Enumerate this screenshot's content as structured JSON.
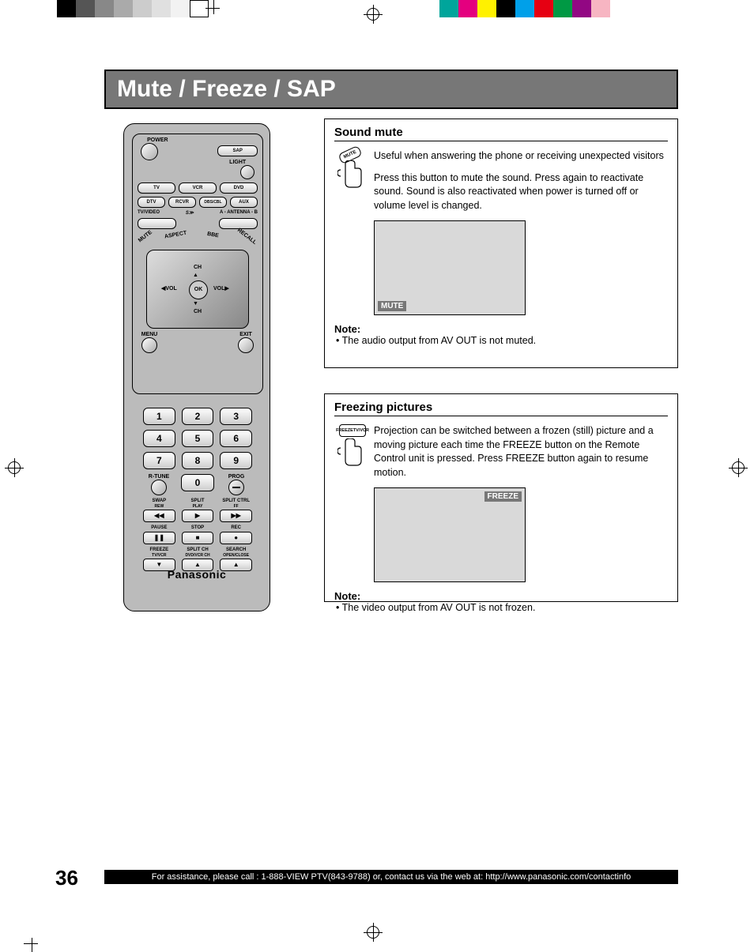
{
  "page": {
    "number": "36",
    "title": "Mute / Freeze / SAP",
    "footer": "For assistance, please call : 1-888-VIEW PTV(843-9788) or, contact us via the web at: http://www.panasonic.com/contactinfo"
  },
  "color_bars": {
    "left": [
      "#000000",
      "#555555",
      "#888888",
      "#aaaaaa",
      "#cccccc",
      "#e0e0e0",
      "#f2f2f2",
      "#ffffff"
    ],
    "right": [
      "#00a59b",
      "#e4007f",
      "#fff100",
      "#000000",
      "#00a0e9",
      "#e60012",
      "#009944",
      "#920783",
      "#f7b5c2",
      "#ffffff"
    ]
  },
  "remote": {
    "brand": "Panasonic",
    "top_labels": {
      "power": "POWER",
      "sap": "SAP",
      "light": "LIGHT"
    },
    "device_row1": [
      "TV",
      "VCR",
      "DVD"
    ],
    "device_row2": [
      "DTV",
      "RCVR",
      "DBS/CBL",
      "AUX"
    ],
    "mid_labels": {
      "tvvideo": "TV/VIDEO",
      "antenna": "A - ANTENNA - B"
    },
    "angled": {
      "mute": "MUTE",
      "aspect": "ASPECT",
      "bbe": "BBE",
      "recall": "RECALL"
    },
    "dpad": {
      "ch": "CH",
      "vol": "VOL",
      "ok": "OK",
      "menu": "MENU",
      "exit": "EXIT"
    },
    "numbers": [
      "1",
      "2",
      "3",
      "4",
      "5",
      "6",
      "7",
      "8",
      "9",
      "0"
    ],
    "num_side": {
      "rtune": "R-TUNE",
      "prog": "PROG"
    },
    "media_row1_labels": [
      "SWAP",
      "SPLIT",
      "SPLIT CTRL"
    ],
    "media_row1_sub": [
      "REW",
      "PLAY",
      "FF"
    ],
    "media_row2_labels": [
      "PAUSE",
      "STOP",
      "REC"
    ],
    "media_row3_labels": [
      "FREEZE",
      "SPLIT CH",
      "SEARCH"
    ],
    "media_row3_sub": [
      "TV/VCR",
      "DVD/VCR CH",
      "OPEN/CLOSE"
    ]
  },
  "sound_mute": {
    "title": "Sound mute",
    "icon_label": "MUTE",
    "para1": "Useful when answering the phone or receiving unexpected visitors",
    "para2": "Press this button to mute the sound. Press again to reactivate sound. Sound is also reactivated when power is turned off or volume level is changed.",
    "osd_tag": "MUTE",
    "note_head": "Note:",
    "note_body": "•  The audio output from AV OUT is not muted."
  },
  "freeze": {
    "title": "Freezing pictures",
    "icon_label_top": "FREEZE",
    "icon_label_bottom": "TV/VCR",
    "para1": "Projection can be switched between a frozen (still) picture and a moving picture each time the FREEZE button on the Remote Control unit is pressed. Press FREEZE button again to resume motion.",
    "osd_tag": "FREEZE",
    "note_head": "Note:",
    "note_body": "•  The video output from AV OUT is not frozen."
  }
}
